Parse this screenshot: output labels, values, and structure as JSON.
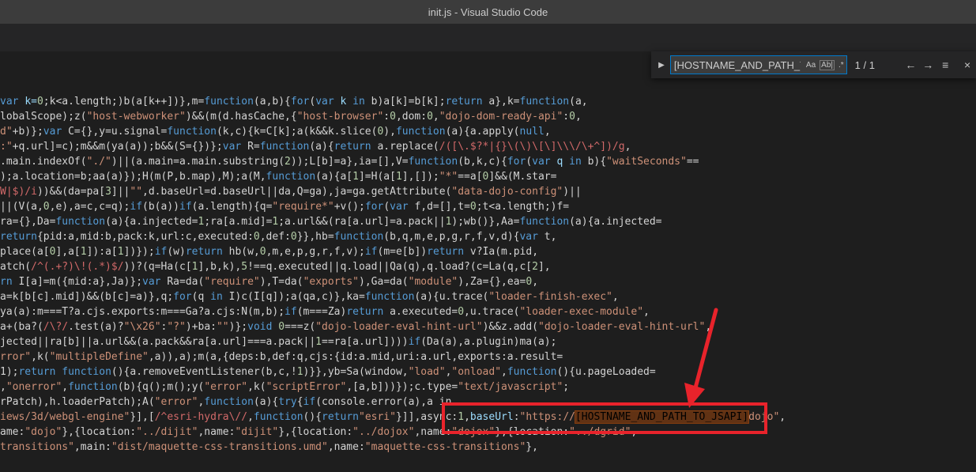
{
  "window": {
    "title": "init.js - Visual Studio Code"
  },
  "find_widget": {
    "toggle_icon": "chevron-right-icon",
    "query": "[HOSTNAME_AND_PATH_TO_JSAPI]",
    "options": [
      "Aa",
      "Ab|",
      ".*"
    ],
    "match_count": "1 / 1",
    "buttons": {
      "prev": "←",
      "next": "→",
      "selection": "≡",
      "close": "×"
    }
  },
  "colors": {
    "highlight_border": "#e8232b",
    "editor_bg": "#1e1e1e",
    "accent": "#007acc"
  },
  "code_lines": [
    [
      [
        "var ",
        "kw"
      ],
      [
        "k=",
        "var"
      ],
      [
        "0",
        "num"
      ],
      [
        ";k<a.length;)b(a[k++])},m=",
        "plain"
      ],
      [
        "function",
        "kw"
      ],
      [
        "(a,b){",
        "plain"
      ],
      [
        "for",
        "kw"
      ],
      [
        "(",
        "plain"
      ],
      [
        "var ",
        "kw"
      ],
      [
        "k ",
        "var"
      ],
      [
        "in ",
        "kw"
      ],
      [
        "b)a[k]=b[k];",
        "plain"
      ],
      [
        "return ",
        "kw"
      ],
      [
        "a},k=",
        "plain"
      ],
      [
        "function",
        "kw"
      ],
      [
        "(a,",
        "plain"
      ]
    ],
    [
      [
        "lobalScope);z(",
        "plain"
      ],
      [
        "\"host-webworker\"",
        "str"
      ],
      [
        ")&&(m(d.hasCache,{",
        "plain"
      ],
      [
        "\"host-browser\"",
        "str"
      ],
      [
        ":",
        "plain"
      ],
      [
        "0",
        "num"
      ],
      [
        ",dom:",
        "plain"
      ],
      [
        "0",
        "num"
      ],
      [
        ",",
        "plain"
      ],
      [
        "\"dojo-dom-ready-api\"",
        "str"
      ],
      [
        ":",
        "plain"
      ],
      [
        "0",
        "num"
      ],
      [
        ",",
        "plain"
      ]
    ],
    [
      [
        "d\"",
        "str"
      ],
      [
        "+b)};",
        "plain"
      ],
      [
        "var ",
        "kw"
      ],
      [
        "C={},y=u.signal=",
        "plain"
      ],
      [
        "function",
        "kw"
      ],
      [
        "(k,c){k=C[k];a(k&&k.slice(",
        "plain"
      ],
      [
        "0",
        "num"
      ],
      [
        "),",
        "plain"
      ],
      [
        "function",
        "kw"
      ],
      [
        "(a){a.apply(",
        "plain"
      ],
      [
        "null",
        "kw"
      ],
      [
        ",",
        "plain"
      ]
    ],
    [
      [
        ":\"",
        "str"
      ],
      [
        "+q.url]=c);m&&m(ya(a));b&&(S={})};",
        "plain"
      ],
      [
        "var ",
        "kw"
      ],
      [
        "R=",
        "plain"
      ],
      [
        "function",
        "kw"
      ],
      [
        "(a){",
        "plain"
      ],
      [
        "return ",
        "kw"
      ],
      [
        "a.replace(",
        "plain"
      ],
      [
        "/([\\.$?*|{}\\(\\)\\[\\]\\\\\\/\\+^])/g",
        "re"
      ],
      [
        ",",
        "plain"
      ]
    ],
    [
      [
        ".main.indexOf(",
        "plain"
      ],
      [
        "\"./\"",
        "str"
      ],
      [
        ")||(a.main=a.main.substring(",
        "plain"
      ],
      [
        "2",
        "num"
      ],
      [
        "));L[b]=a},ia=[],V=",
        "plain"
      ],
      [
        "function",
        "kw"
      ],
      [
        "(b,k,c){",
        "plain"
      ],
      [
        "for",
        "kw"
      ],
      [
        "(",
        "plain"
      ],
      [
        "var ",
        "kw"
      ],
      [
        "q ",
        "var"
      ],
      [
        "in ",
        "kw"
      ],
      [
        "b){",
        "plain"
      ],
      [
        "\"waitSeconds\"",
        "str"
      ],
      [
        "==",
        "plain"
      ]
    ],
    [
      [
        ");a.location=b;aa(a)});H(m(P,b.map),M);a(M,",
        "plain"
      ],
      [
        "function",
        "kw"
      ],
      [
        "(a){a[",
        "plain"
      ],
      [
        "1",
        "num"
      ],
      [
        "]=H(a[",
        "plain"
      ],
      [
        "1",
        "num"
      ],
      [
        "],[]);",
        "plain"
      ],
      [
        "\"*\"",
        "str"
      ],
      [
        "==a[",
        "plain"
      ],
      [
        "0",
        "num"
      ],
      [
        "]&&(M.star=",
        "plain"
      ]
    ],
    [
      [
        "W|$)/i",
        "re"
      ],
      [
        "))&&(da=pa[",
        "plain"
      ],
      [
        "3",
        "num"
      ],
      [
        "]||",
        "plain"
      ],
      [
        "\"\"",
        "str"
      ],
      [
        ",d.baseUrl=d.baseUrl||da,Q=ga),ja=ga.getAttribute(",
        "plain"
      ],
      [
        "\"data-dojo-config\"",
        "str"
      ],
      [
        ")||",
        "plain"
      ]
    ],
    [
      [
        "||(V(a,",
        "plain"
      ],
      [
        "0",
        "num"
      ],
      [
        ",e),a=c,c=q);",
        "plain"
      ],
      [
        "if",
        "kw"
      ],
      [
        "(b(a))",
        "plain"
      ],
      [
        "if",
        "kw"
      ],
      [
        "(a.length){q=",
        "plain"
      ],
      [
        "\"require*\"",
        "str"
      ],
      [
        "+v();",
        "plain"
      ],
      [
        "for",
        "kw"
      ],
      [
        "(",
        "plain"
      ],
      [
        "var ",
        "kw"
      ],
      [
        "f,d=[],t=",
        "plain"
      ],
      [
        "0",
        "num"
      ],
      [
        ";t<a.length;)f=",
        "plain"
      ]
    ],
    [
      [
        "ra={},Da=",
        "plain"
      ],
      [
        "function",
        "kw"
      ],
      [
        "(a){a.injected=",
        "plain"
      ],
      [
        "1",
        "num"
      ],
      [
        ";ra[a.mid]=",
        "plain"
      ],
      [
        "1",
        "num"
      ],
      [
        ";a.url&&(ra[a.url]=a.pack||",
        "plain"
      ],
      [
        "1",
        "num"
      ],
      [
        ");wb()},Aa=",
        "plain"
      ],
      [
        "function",
        "kw"
      ],
      [
        "(a){a.injected=",
        "plain"
      ]
    ],
    [
      [
        "return",
        "kw"
      ],
      [
        "{pid:a,mid:b,pack:k,url:c,executed:",
        "plain"
      ],
      [
        "0",
        "num"
      ],
      [
        ",def:",
        "plain"
      ],
      [
        "0",
        "num"
      ],
      [
        "}},hb=",
        "plain"
      ],
      [
        "function",
        "kw"
      ],
      [
        "(b,q,m,e,p,g,r,f,v,d){",
        "plain"
      ],
      [
        "var ",
        "kw"
      ],
      [
        "t,",
        "plain"
      ]
    ],
    [
      [
        "place(a[",
        "plain"
      ],
      [
        "0",
        "num"
      ],
      [
        "],a[",
        "plain"
      ],
      [
        "1",
        "num"
      ],
      [
        "]):a[",
        "plain"
      ],
      [
        "1",
        "num"
      ],
      [
        "])});",
        "plain"
      ],
      [
        "if",
        "kw"
      ],
      [
        "(w)",
        "plain"
      ],
      [
        "return ",
        "kw"
      ],
      [
        "hb(w,",
        "plain"
      ],
      [
        "0",
        "num"
      ],
      [
        ",m,e,p,g,r,f,v);",
        "plain"
      ],
      [
        "if",
        "kw"
      ],
      [
        "(m=e[b])",
        "plain"
      ],
      [
        "return ",
        "kw"
      ],
      [
        "v?Ia(m.pid,",
        "plain"
      ]
    ],
    [
      [
        "atch(",
        "plain"
      ],
      [
        "/^(.+?)\\!(.*)$/",
        "re"
      ],
      [
        "))?(q=Ha(c[",
        "plain"
      ],
      [
        "1",
        "num"
      ],
      [
        "],b,k),",
        "plain"
      ],
      [
        "5",
        "num"
      ],
      [
        "!==q.executed||q.load||Qa(q),q.load?(c=La(q,c[",
        "plain"
      ],
      [
        "2",
        "num"
      ],
      [
        "],",
        "plain"
      ]
    ],
    [
      [
        "rn ",
        "kw"
      ],
      [
        "I[a]=m({mid:a},Ja)};",
        "plain"
      ],
      [
        "var ",
        "kw"
      ],
      [
        "Ra=da(",
        "plain"
      ],
      [
        "\"require\"",
        "str"
      ],
      [
        "),T=da(",
        "plain"
      ],
      [
        "\"exports\"",
        "str"
      ],
      [
        "),Ga=da(",
        "plain"
      ],
      [
        "\"module\"",
        "str"
      ],
      [
        "),Za={},ea=",
        "plain"
      ],
      [
        "0",
        "num"
      ],
      [
        ",",
        "plain"
      ]
    ],
    [
      [
        "a=k[b[c].mid])&&(b[c]=a)},q;",
        "plain"
      ],
      [
        "for",
        "kw"
      ],
      [
        "(q ",
        "plain"
      ],
      [
        "in ",
        "kw"
      ],
      [
        "I)c(I[q]);a(qa,c)},ka=",
        "plain"
      ],
      [
        "function",
        "kw"
      ],
      [
        "(a){u.trace(",
        "plain"
      ],
      [
        "\"loader-finish-exec\"",
        "str"
      ],
      [
        ",",
        "plain"
      ]
    ],
    [
      [
        "ya(a):m===T?a.cjs.exports:m===Ga?a.cjs:N(m,b);",
        "plain"
      ],
      [
        "if",
        "kw"
      ],
      [
        "(m===Za)",
        "plain"
      ],
      [
        "return ",
        "kw"
      ],
      [
        "a.executed=",
        "plain"
      ],
      [
        "0",
        "num"
      ],
      [
        ",u.trace(",
        "plain"
      ],
      [
        "\"loader-exec-module\"",
        "str"
      ],
      [
        ",",
        "plain"
      ]
    ],
    [
      [
        "a+(ba?(",
        "plain"
      ],
      [
        "/\\?/",
        "re"
      ],
      [
        ".test(a)?",
        "plain"
      ],
      [
        "\"\\x26\"",
        "str"
      ],
      [
        ":",
        "plain"
      ],
      [
        "\"?\"",
        "str"
      ],
      [
        ")+ba:",
        "plain"
      ],
      [
        "\"\"",
        "str"
      ],
      [
        ")};",
        "plain"
      ],
      [
        "void ",
        "kw"
      ],
      [
        "0",
        "num"
      ],
      [
        "===z(",
        "plain"
      ],
      [
        "\"dojo-loader-eval-hint-url\"",
        "str"
      ],
      [
        ")&&z.add(",
        "plain"
      ],
      [
        "\"dojo-loader-eval-hint-url\"",
        "str"
      ],
      [
        ",",
        "plain"
      ]
    ],
    [
      [
        "jected||ra[b]||a.url&&(a.pack&&ra[a.url]===a.pack||",
        "plain"
      ],
      [
        "1",
        "num"
      ],
      [
        "==ra[a.url])))",
        "plain"
      ],
      [
        "if",
        "kw"
      ],
      [
        "(Da(a),a.plugin)ma(a);",
        "plain"
      ]
    ],
    [
      [
        "rror\"",
        "str"
      ],
      [
        ",k(",
        "plain"
      ],
      [
        "\"multipleDefine\"",
        "str"
      ],
      [
        ",a)),a);m(a,{deps:b,def:q,cjs:{id:a.mid,uri:a.url,exports:a.result=",
        "plain"
      ]
    ],
    [
      [
        "1);",
        "plain"
      ],
      [
        "return ",
        "kw"
      ],
      [
        "function",
        "kw"
      ],
      [
        "(){a.removeEventListener(b,c,!",
        "plain"
      ],
      [
        "1",
        "num"
      ],
      [
        ")}},yb=Sa(window,",
        "plain"
      ],
      [
        "\"load\"",
        "str"
      ],
      [
        ",",
        "plain"
      ],
      [
        "\"onload\"",
        "str"
      ],
      [
        ",",
        "plain"
      ],
      [
        "function",
        "kw"
      ],
      [
        "(){u.pageLoaded=",
        "plain"
      ]
    ],
    [
      [
        ",",
        "plain"
      ],
      [
        "\"onerror\"",
        "str"
      ],
      [
        ",",
        "plain"
      ],
      [
        "function",
        "kw"
      ],
      [
        "(b){q();m();y(",
        "plain"
      ],
      [
        "\"error\"",
        "str"
      ],
      [
        ",k(",
        "plain"
      ],
      [
        "\"scriptError\"",
        "str"
      ],
      [
        ",[a,b]))});c.type=",
        "plain"
      ],
      [
        "\"text/javascript\"",
        "str"
      ],
      [
        ";",
        "plain"
      ]
    ],
    [
      [
        "rPatch),h.loaderPatch);A(",
        "plain"
      ],
      [
        "\"error\"",
        "str"
      ],
      [
        ",",
        "plain"
      ],
      [
        "function",
        "kw"
      ],
      [
        "(a){",
        "plain"
      ],
      [
        "try",
        "kw"
      ],
      [
        "{",
        "plain"
      ],
      [
        "if",
        "kw"
      ],
      [
        "(console.error(a),a in",
        "plain"
      ]
    ],
    [
      [
        "iews/3d/webgl-engine\"",
        "str"
      ],
      [
        "}],[",
        "plain"
      ],
      [
        "/^esri-hydra\\//",
        "re"
      ],
      [
        ",",
        "plain"
      ],
      [
        "function",
        "kw"
      ],
      [
        "(){",
        "plain"
      ],
      [
        "return",
        "kw"
      ],
      [
        "\"esri\"",
        "str"
      ],
      [
        "}]],async:",
        "plain"
      ],
      [
        "1",
        "num"
      ],
      [
        ",",
        "plain"
      ],
      [
        "baseUrl",
        "var"
      ],
      [
        ":",
        "plain"
      ],
      [
        "\"https://",
        "str"
      ],
      [
        "[HOSTNAME_AND_PATH_TO_JSAPI]",
        "find"
      ],
      [
        "dojo\"",
        "str"
      ],
      [
        ",",
        "plain"
      ]
    ],
    [
      [
        "ame:",
        "plain"
      ],
      [
        "\"dojo\"",
        "str"
      ],
      [
        "},{location:",
        "plain"
      ],
      [
        "\"../dijit\"",
        "str"
      ],
      [
        ",name:",
        "plain"
      ],
      [
        "\"dijit\"",
        "str"
      ],
      [
        "},{location:",
        "plain"
      ],
      [
        "\"../dojox\"",
        "str"
      ],
      [
        ",name:",
        "plain"
      ],
      [
        "\"dojox\"",
        "str"
      ],
      [
        "},{location:",
        "plain"
      ],
      [
        "\"../dgrid\"",
        "str"
      ],
      [
        ",",
        "plain"
      ]
    ],
    [
      [
        "transitions\"",
        "str"
      ],
      [
        ",main:",
        "plain"
      ],
      [
        "\"dist/maquette-css-transitions.umd\"",
        "str"
      ],
      [
        ",name:",
        "plain"
      ],
      [
        "\"maquette-css-transitions\"",
        "str"
      ],
      [
        "},",
        "plain"
      ]
    ]
  ]
}
